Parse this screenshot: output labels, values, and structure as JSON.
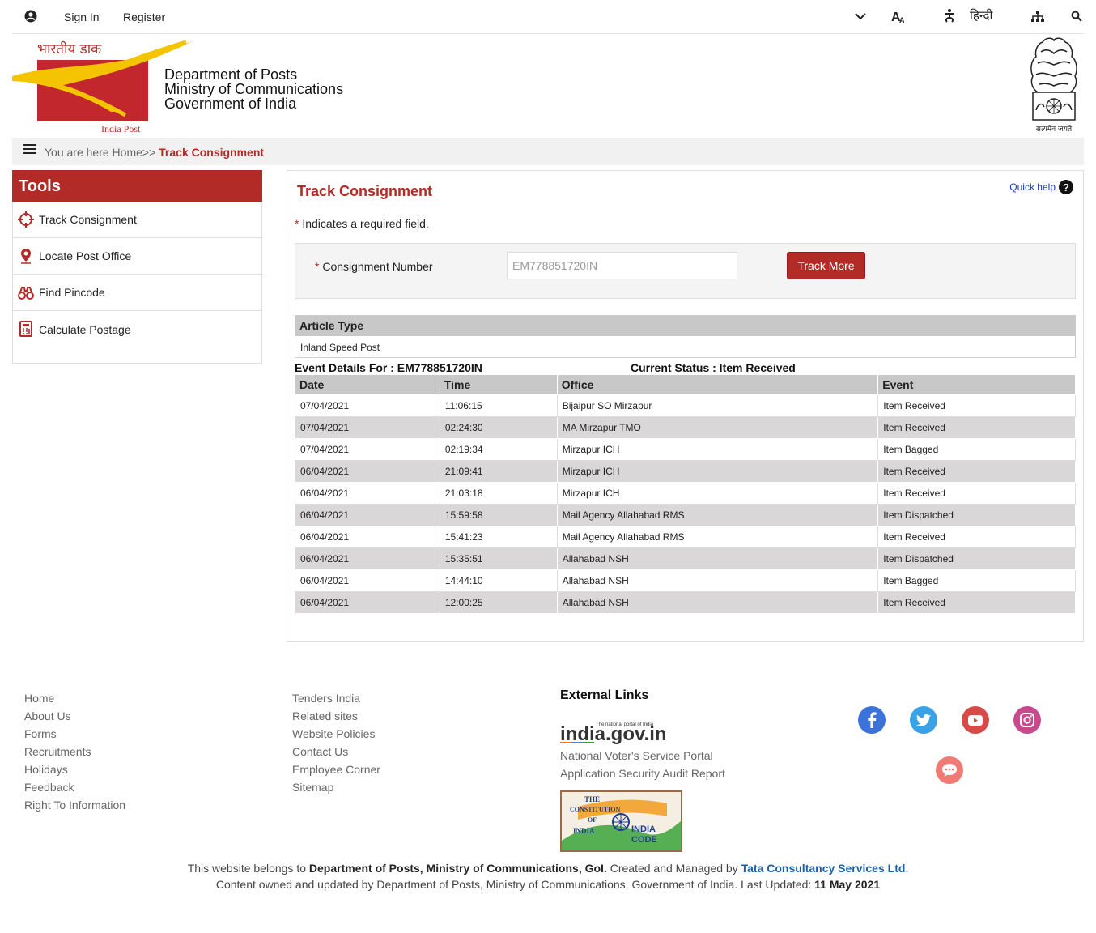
{
  "topbar": {
    "signin": "Sign In",
    "register": "Register",
    "hindi": "हिन्दी"
  },
  "header": {
    "logo_hindi": "भारतीय डाक",
    "logo_caption": "India Post",
    "dept_line1": "Department of Posts",
    "dept_line2": "Ministry of Communications",
    "dept_line3": "Government of India",
    "emblem_caption": "सत्यमेव जयते"
  },
  "breadcrumb": {
    "prefix": "You are here Home>> ",
    "current": "Track Consignment"
  },
  "tools": {
    "title": "Tools",
    "items": [
      {
        "label": "Track Consignment",
        "icon": "crosshair-icon"
      },
      {
        "label": "Locate Post Office",
        "icon": "map-pin-icon"
      },
      {
        "label": "Find Pincode",
        "icon": "binoculars-icon"
      },
      {
        "label": "Calculate Postage",
        "icon": "calculator-icon"
      }
    ]
  },
  "main": {
    "title": "Track Consignment",
    "quick_help": "Quick help",
    "required_note": "Indicates a required field.",
    "consignment_label": "Consignment Number",
    "consignment_value": "EM778851720IN",
    "track_button": "Track More",
    "article_type_header": "Article Type",
    "article_type_value": "Inland Speed Post",
    "event_details": "Event Details For : EM778851720IN",
    "current_status": "Current Status : Item Received",
    "columns": [
      "Date",
      "Time",
      "Office",
      "Event"
    ],
    "rows": [
      [
        "07/04/2021",
        "11:06:15",
        "Bijaipur SO Mirzapur",
        "Item Received"
      ],
      [
        "07/04/2021",
        "02:24:30",
        "MA Mirzapur TMO",
        "Item Received"
      ],
      [
        "07/04/2021",
        "02:19:34",
        "Mirzapur ICH",
        "Item Bagged"
      ],
      [
        "06/04/2021",
        "21:09:41",
        "Mirzapur ICH",
        "Item Received"
      ],
      [
        "06/04/2021",
        "21:03:18",
        "Mirzapur ICH",
        "Item Received"
      ],
      [
        "06/04/2021",
        "15:59:58",
        "Mail Agency Allahabad RMS",
        "Item Dispatched"
      ],
      [
        "06/04/2021",
        "15:41:23",
        "Mail Agency Allahabad RMS",
        "Item Received"
      ],
      [
        "06/04/2021",
        "15:35:51",
        "Allahabad NSH",
        "Item Dispatched"
      ],
      [
        "06/04/2021",
        "14:44:10",
        "Allahabad NSH",
        "Item Bagged"
      ],
      [
        "06/04/2021",
        "12:00:25",
        "Allahabad NSH",
        "Item Received"
      ]
    ]
  },
  "footer": {
    "col1": [
      "Home",
      "About Us",
      "Forms",
      "Recruitments",
      "Holidays",
      "Feedback",
      "Right To Information"
    ],
    "col2": [
      "Tenders India",
      "Related sites",
      "Website Policies",
      "Contact Us",
      "Employee Corner",
      "Sitemap"
    ],
    "external_title": "External Links",
    "indiagov_text": "india.gov.in",
    "indiagov_tagline": "The national portal of India",
    "external_links": [
      "National Voter's Service Portal",
      "Application Security Audit Report"
    ],
    "constitution_line1": "THE",
    "constitution_line2": "CONSTITUTION",
    "constitution_line3": "OF",
    "constitution_line4": "INDIA",
    "constitution_code1": "INDIA",
    "constitution_code2": "CODE",
    "copy1_a": "This website belongs to ",
    "copy1_b": "Department of Posts, Ministry of Communications, GoI.",
    "copy1_c": " Created and Managed by ",
    "copy1_d": "Tata Consultancy Services Ltd",
    "copy1_e": ".",
    "copy2_a": "Content owned and updated by Department of Posts, Ministry of Communications, Government of India. Last Updated: ",
    "copy2_b": "11 May 2021"
  },
  "colors": {
    "brand_red": "#b22b27",
    "facebook": "#3b73d8",
    "twitter": "#3aa1e6",
    "youtube": "#d64a48",
    "instagram": "#c9498f",
    "chat": "#f07b74"
  }
}
